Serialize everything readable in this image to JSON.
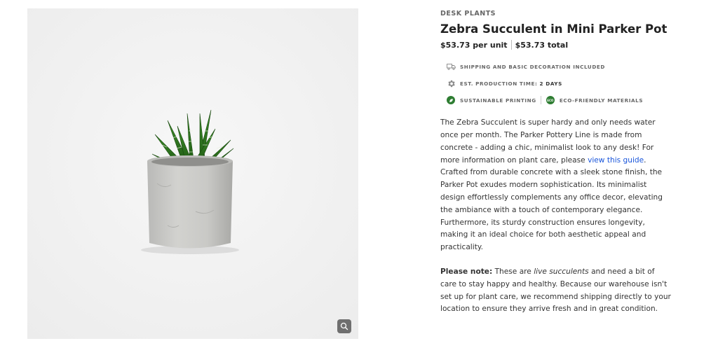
{
  "product": {
    "category": "DESK PLANTS",
    "title": "Zebra Succulent in Mini Parker Pot",
    "price_per_unit": "$53.73 per unit",
    "price_total": "$53.73 total"
  },
  "features": {
    "shipping": "SHIPPING AND BASIC DECORATION INCLUDED",
    "production_label": "EST. PRODUCTION TIME:",
    "production_value": "2 DAYS",
    "sustainable": "SUSTAINABLE PRINTING",
    "eco": "ECO-FRIENDLY MATERIALS",
    "eco_badge": "ECO"
  },
  "description": {
    "part1": "The Zebra Succulent is super hardy and only needs water once per month. The Parker Pottery Line is made from concrete - adding a chic, minimalist look to any desk! For more information on plant care, please ",
    "link": "view this guide",
    "part2": ". Crafted from durable concrete with a sleek stone finish, the Parker Pot exudes modern sophistication. Its minimalist design effortlessly complements any office decor, elevating the ambiance with a touch of contemporary elegance. Furthermore, its sturdy construction ensures longevity, making it an ideal choice for both aesthetic appeal and practicality."
  },
  "note": {
    "label": "Please note:",
    "part1": " These are ",
    "emph": "live succulents",
    "part2": " and need a bit of care to stay happy and healthy. Because our warehouse isn't set up for plant care, we recommend shipping directly to your location to ensure they arrive fresh and in great condition."
  },
  "colors": {
    "accent_link": "#1a56db",
    "eco_green": "#2e7d32",
    "zoom_button": "#6f6f6f"
  },
  "icons": {
    "shipping": "truck-icon",
    "production": "gear-icon",
    "sustainable": "leaf-icon",
    "eco": "eco-badge-icon",
    "zoom": "magnifier-icon"
  }
}
